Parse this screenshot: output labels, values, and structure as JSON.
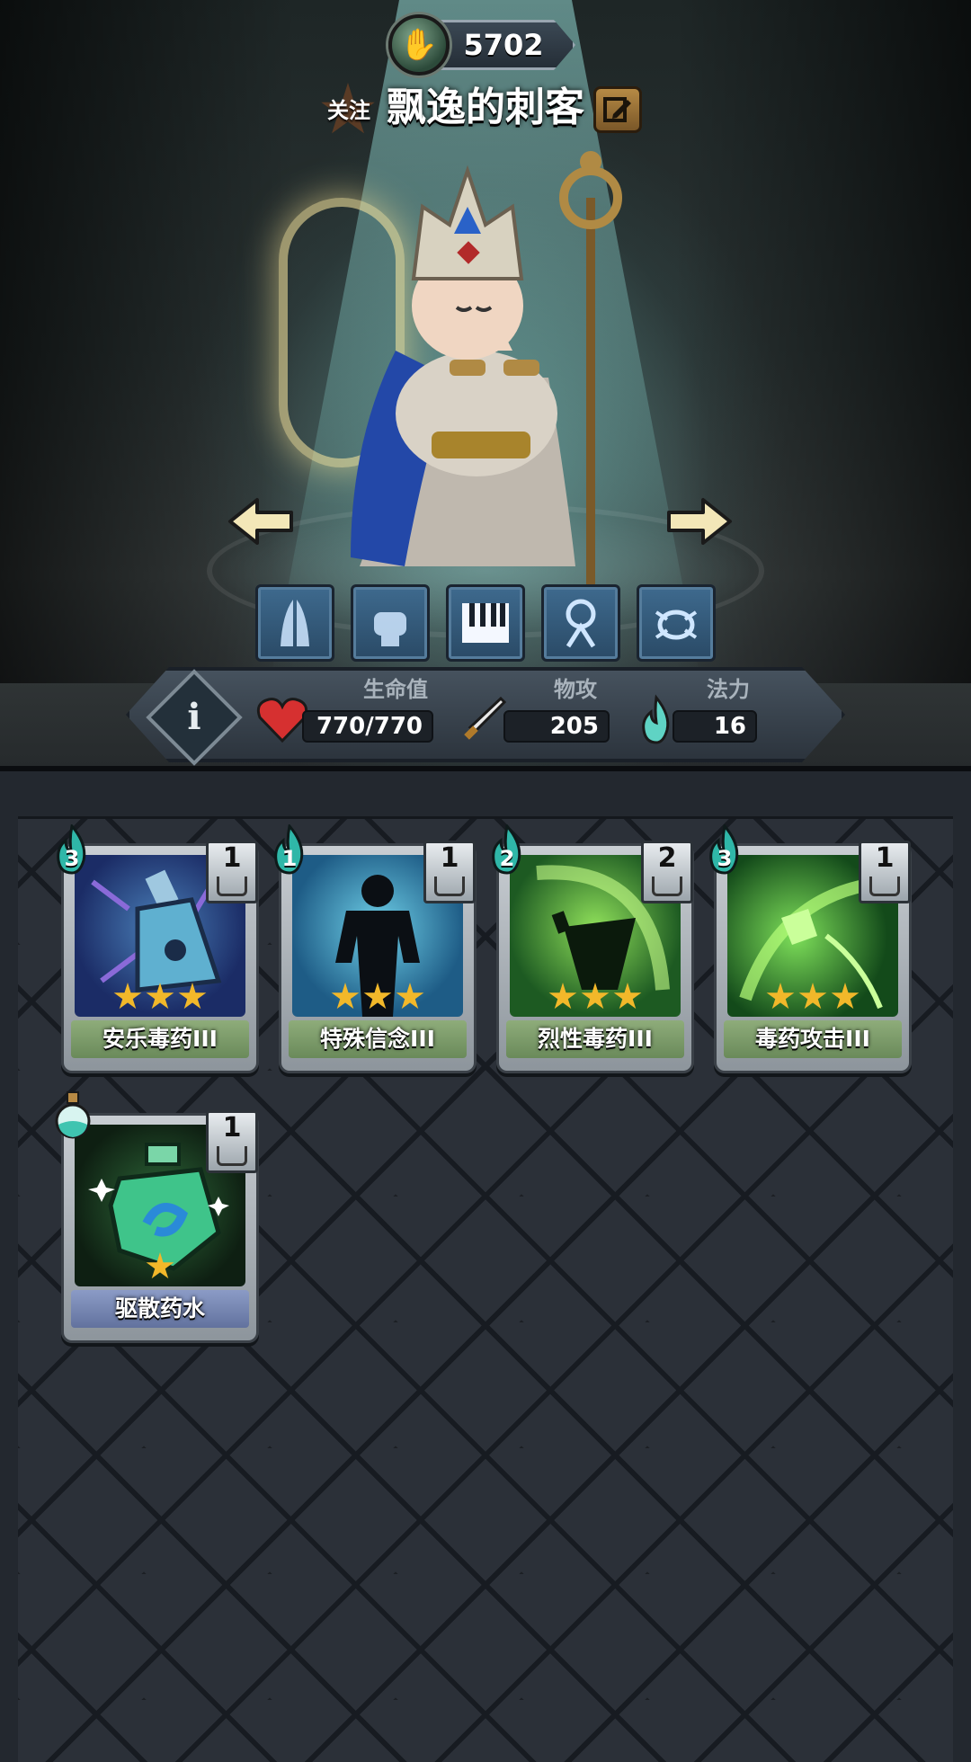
{
  "currency": {
    "value": "5702",
    "icon": "goblin-hand-coin-icon"
  },
  "profile": {
    "follow_label": "关注",
    "name": "飘逸的刺客",
    "edit_icon": "edit-pencil-icon"
  },
  "skills": [
    {
      "icon": "praying-hands-icon"
    },
    {
      "icon": "fist-icon"
    },
    {
      "icon": "piano-keys-icon"
    },
    {
      "icon": "idol-figure-icon"
    },
    {
      "icon": "bug-creature-icon"
    }
  ],
  "stats": {
    "info_icon": "i",
    "hp_label": "生命值",
    "hp_value": "770/770",
    "atk_label": "物攻",
    "atk_value": "205",
    "mana_label": "法力",
    "mana_value": "16"
  },
  "cards": [
    {
      "name": "安乐毒药III",
      "cost": "3",
      "level": "1",
      "stars": 3,
      "theme": "blue-poison"
    },
    {
      "name": "特殊信念III",
      "cost": "1",
      "level": "1",
      "stars": 3,
      "theme": "silhouette"
    },
    {
      "name": "烈性毒药III",
      "cost": "2",
      "level": "2",
      "stars": 3,
      "theme": "green-flask"
    },
    {
      "name": "毒药攻击III",
      "cost": "3",
      "level": "1",
      "stars": 3,
      "theme": "green-swirl"
    },
    {
      "name": "驱散药水",
      "cost": "",
      "level": "1",
      "stars": 1,
      "theme": "potion"
    }
  ],
  "colors": {
    "accent_gold": "#f2b82a",
    "mana_teal": "#5fd3c4",
    "hp_red": "#d63030"
  }
}
